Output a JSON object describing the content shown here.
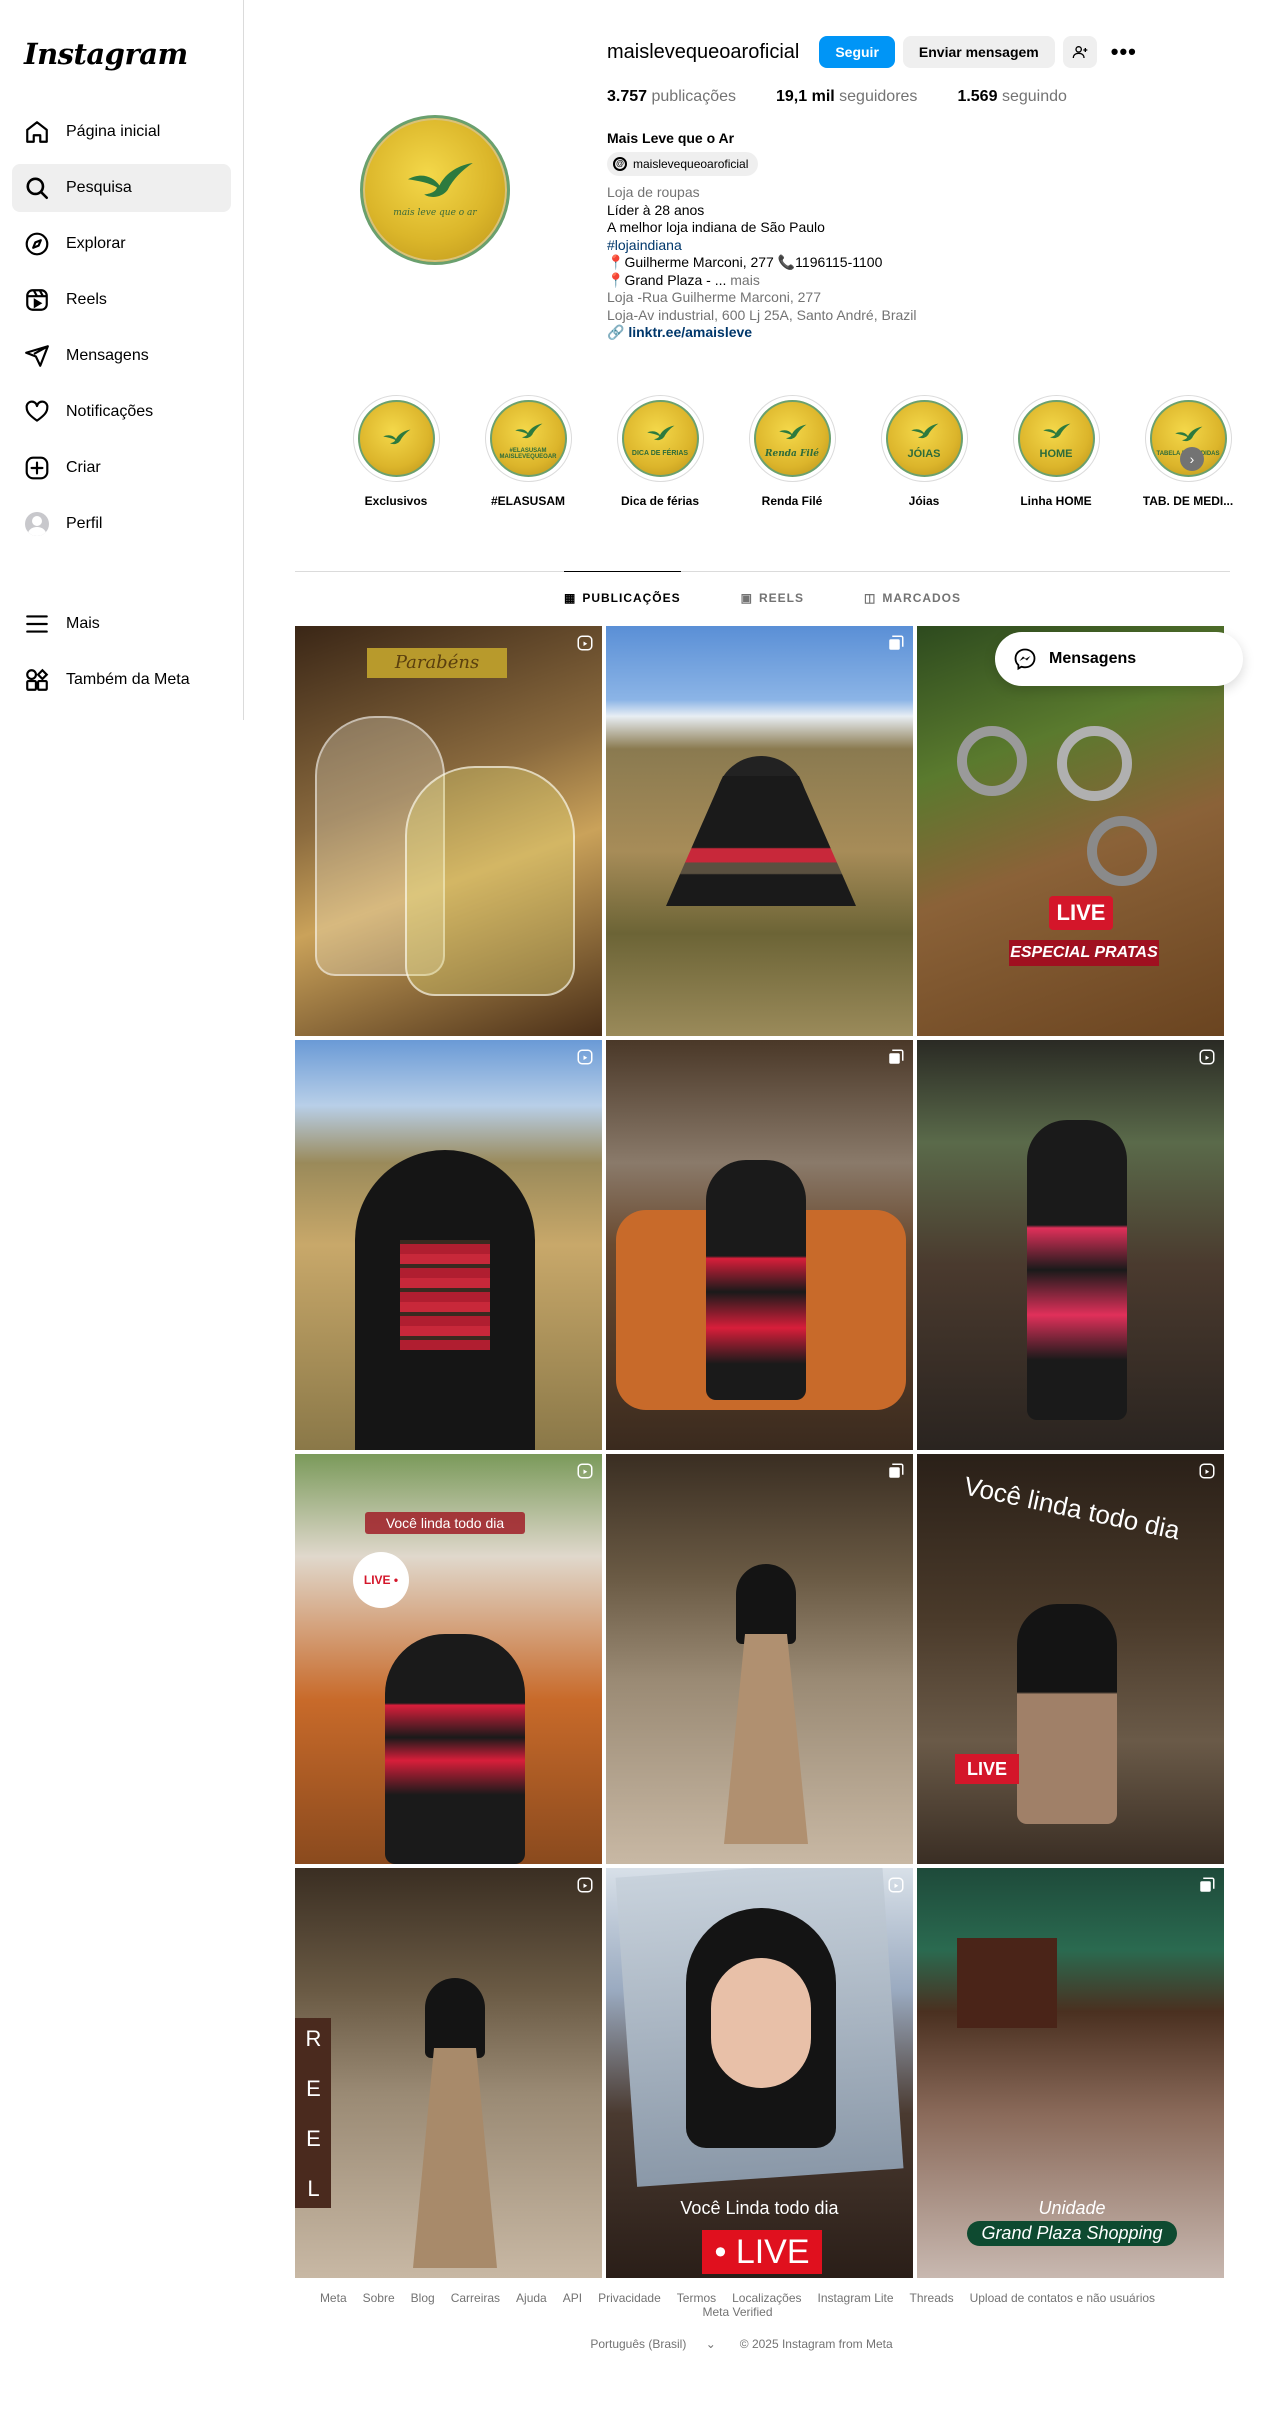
{
  "sidebar": {
    "logo": "Instagram",
    "items": [
      {
        "label": "Página inicial",
        "icon": "home-icon"
      },
      {
        "label": "Pesquisa",
        "icon": "search-icon"
      },
      {
        "label": "Explorar",
        "icon": "compass-icon"
      },
      {
        "label": "Reels",
        "icon": "reels-icon"
      },
      {
        "label": "Mensagens",
        "icon": "messages-icon"
      },
      {
        "label": "Notificações",
        "icon": "heart-icon"
      },
      {
        "label": "Criar",
        "icon": "plus-square-icon"
      },
      {
        "label": "Perfil",
        "icon": "avatar"
      }
    ],
    "bottom_items": [
      {
        "label": "Mais",
        "icon": "menu-icon"
      },
      {
        "label": "Também da Meta",
        "icon": "meta-apps-icon"
      }
    ],
    "active_index": 1
  },
  "profile": {
    "username": "maislevequeoaroficial",
    "follow_button": "Seguir",
    "message_button": "Enviar mensagem",
    "stats": {
      "posts_count": "3.757",
      "posts_label": "publicações",
      "followers_count": "19,1 mil",
      "followers_label": "seguidores",
      "following_count": "1.569",
      "following_label": "seguindo"
    },
    "full_name": "Mais Leve que o Ar",
    "threads_handle": "maislevequeoaroficial",
    "category": "Loja de roupas",
    "bio_lines": [
      "Líder à 28 anos",
      "A melhor loja indiana de São Paulo"
    ],
    "hashtag": "#lojaindiana",
    "address1": "Guilherme Marconi, 277",
    "phone": "1196115-1100",
    "address2": "Grand Plaza - ...",
    "more": "mais",
    "location1": "Loja -Rua Guilherme Marconi, 277",
    "location2": "Loja-Av industrial, 600 Lj 25A, Santo André, Brazil",
    "link": "linktr.ee/amaisleve",
    "logo_text": "mais leve que o ar"
  },
  "highlights": [
    {
      "label": "Exclusivos",
      "text": ""
    },
    {
      "label": "#ELASUSAM",
      "text": "#ELASUSAM MAISLEVEQUEOAR"
    },
    {
      "label": "Dica de férias",
      "text": "DICA DE FÉRIAS"
    },
    {
      "label": "Renda Filé",
      "text": "Renda Filé"
    },
    {
      "label": "Jóias",
      "text": "JÓIAS"
    },
    {
      "label": "Linha HOME",
      "text": "HOME"
    },
    {
      "label": "TAB. DE MEDI...",
      "text": "TABELA DE MEDIDAS"
    }
  ],
  "tabs": [
    {
      "label": "PUBLICAÇÕES",
      "icon": "grid-icon"
    },
    {
      "label": "REELS",
      "icon": "reels-icon"
    },
    {
      "label": "MARCADOS",
      "icon": "tagged-icon"
    }
  ],
  "posts": [
    {
      "type": "reel",
      "overlay": "Parabéns"
    },
    {
      "type": "carousel",
      "overlay": ""
    },
    {
      "type": "carousel",
      "overlay": "LIVE",
      "overlay2": "ESPECIAL PRATAS"
    },
    {
      "type": "reel",
      "overlay": ""
    },
    {
      "type": "carousel",
      "overlay": ""
    },
    {
      "type": "reel",
      "overlay": ""
    },
    {
      "type": "reel",
      "overlay": "Você linda todo dia",
      "overlay2": "LIVE •"
    },
    {
      "type": "carousel",
      "overlay": ""
    },
    {
      "type": "reel",
      "overlay": "Você linda todo dia",
      "overlay2": "LIVE"
    },
    {
      "type": "reel",
      "overlay": "R E E L S"
    },
    {
      "type": "reel",
      "overlay": "Você Linda todo dia",
      "overlay2": "• LIVE"
    },
    {
      "type": "carousel",
      "overlay": "Unidade",
      "overlay2": "Grand Plaza Shopping"
    }
  ],
  "floating_messages": "Mensagens",
  "footer": {
    "links": [
      "Meta",
      "Sobre",
      "Blog",
      "Carreiras",
      "Ajuda",
      "API",
      "Privacidade",
      "Termos",
      "Localizações",
      "Instagram Lite",
      "Threads",
      "Upload de contatos e não usuários",
      "Meta Verified"
    ],
    "language": "Português (Brasil)",
    "copyright": "© 2025 Instagram from Meta"
  },
  "colors": {
    "accent": "#0095f6",
    "gold": "#dbb62a",
    "logo_green": "#2d6b3a"
  }
}
